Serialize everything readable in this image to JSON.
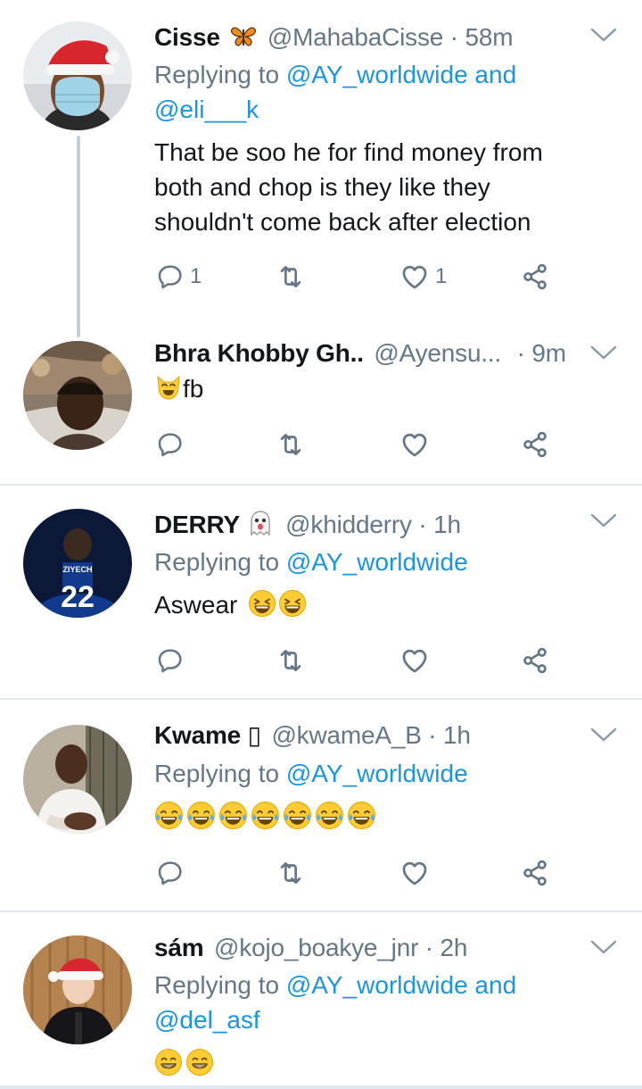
{
  "tweets": [
    {
      "name": "Cisse",
      "name_emoji": "butterfly",
      "handle": "@MahabaCisse",
      "dot": "·",
      "time": "58m",
      "replying_prefix": "Replying to",
      "replying_to": "@AY_worldwide and",
      "replying_to_2": "@eli___k",
      "text_lines": [
        "That be soo he for find money from",
        "both and chop is they like they",
        "shouldn't come back after election"
      ],
      "reply_count": "1",
      "like_count": "1",
      "avatar": "santa-hat-masked-man"
    },
    {
      "name": "Bhra Khobby Gh..",
      "handle": "@Ayensu...",
      "dot": "·",
      "time": "9m",
      "text_emoji": "smiling-cat-emoji",
      "text": "fb",
      "avatar": "man-lying-on-sofa"
    },
    {
      "name": "DERRY",
      "name_emoji": "ghost",
      "handle": "@khidderry",
      "dot": "·",
      "time": "1h",
      "replying_prefix": "Replying to",
      "replying_to": "@AY_worldwide",
      "text": "Aswear",
      "text_emojis": [
        "grinning-squinting-face",
        "grinning-squinting-face"
      ],
      "avatar": "footballer-ziyech-22",
      "jersey_name": "ZIYECH",
      "jersey_number": "22"
    },
    {
      "name": "Kwame",
      "name_glyph": "▯",
      "handle": "@kwameA_B",
      "dot": "·",
      "time": "1h",
      "replying_prefix": "Replying to",
      "replying_to": "@AY_worldwide",
      "text_emojis": [
        "tears-of-joy",
        "tears-of-joy",
        "tears-of-joy",
        "tears-of-joy",
        "tears-of-joy",
        "tears-of-joy",
        "tears-of-joy"
      ],
      "avatar": "man-white-shirt"
    },
    {
      "name": "sám",
      "handle": "@kojo_boakye_jnr",
      "dot": "·",
      "time": "2h",
      "replying_prefix": "Replying to",
      "replying_to": "@AY_worldwide and",
      "replying_to_2": "@del_asf",
      "text_emojis": [
        "beaming-face",
        "beaming-face"
      ],
      "avatar": "man-santa-hat-jacket"
    }
  ],
  "icons": {
    "reply": "reply-icon",
    "retweet": "retweet-icon",
    "like": "like-icon",
    "share": "share-icon",
    "menu": "chevron-down-icon"
  },
  "colors": {
    "link": "#1b95e0",
    "secondary": "#657786",
    "primary_text": "#14171a",
    "divider": "#e1e8ed",
    "thread_line": "#c4cfd6"
  }
}
